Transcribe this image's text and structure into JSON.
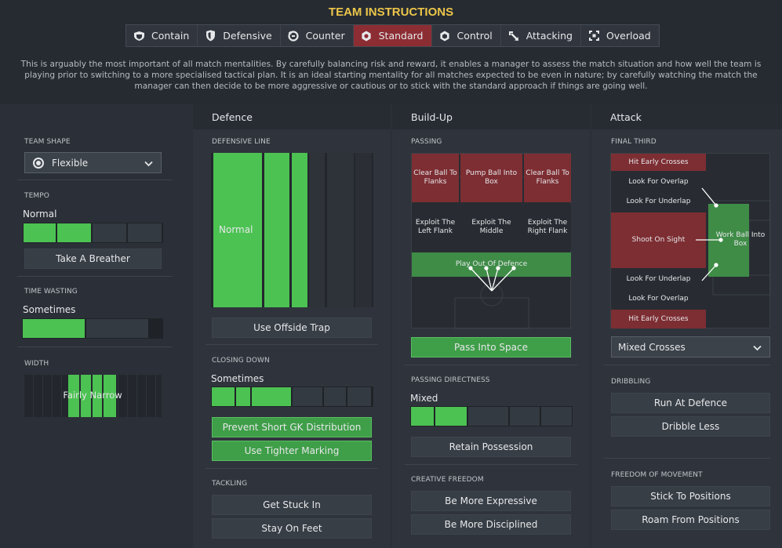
{
  "header": {
    "title": "TEAM INSTRUCTIONS",
    "tabs": [
      {
        "label": "Contain",
        "icon": "contain-icon",
        "active": false
      },
      {
        "label": "Defensive",
        "icon": "defensive-shield-icon",
        "active": false
      },
      {
        "label": "Counter",
        "icon": "counter-icon",
        "active": false
      },
      {
        "label": "Standard",
        "icon": "standard-icon",
        "active": true
      },
      {
        "label": "Control",
        "icon": "control-icon",
        "active": false
      },
      {
        "label": "Attacking",
        "icon": "attacking-icon",
        "active": false
      },
      {
        "label": "Overload",
        "icon": "overload-icon",
        "active": false
      }
    ],
    "description": "This is arguably the most important of all match mentalities. By carefully balancing risk and reward, it enables a manager to assess the match situation and how well the team is playing prior to switching to a more specialised tactical plan. It is an ideal starting mentality for all matches expected to be even in nature; by carefully watching the match the manager can then decide to be more aggressive or cautious or to stick with the standard approach if things are going well."
  },
  "general": {
    "team_shape": {
      "label": "TEAM SHAPE",
      "value": "Flexible"
    },
    "tempo": {
      "label": "TEMPO",
      "value": "Normal",
      "button": "Take A Breather"
    },
    "time_wasting": {
      "label": "TIME WASTING",
      "value": "Sometimes"
    },
    "width": {
      "label": "WIDTH",
      "value": "Fairly Narrow"
    }
  },
  "defence": {
    "header": "Defence",
    "defensive_line": {
      "label": "DEFENSIVE LINE",
      "value": "Normal",
      "button": "Use Offside Trap"
    },
    "closing_down": {
      "label": "CLOSING DOWN",
      "value": "Sometimes",
      "buttons": [
        "Prevent Short GK Distribution",
        "Use Tighter Marking"
      ]
    },
    "tackling": {
      "label": "TACKLING",
      "buttons": [
        "Get Stuck In",
        "Stay On Feet"
      ]
    }
  },
  "buildup": {
    "header": "Build-Up",
    "passing": {
      "label": "PASSING",
      "cells": [
        "Clear Ball To Flanks",
        "Pump Ball Into Box",
        "Clear Ball To Flanks",
        "Exploit The Left Flank",
        "Exploit The Middle",
        "Exploit The Right Flank",
        "Play Out Of Defence"
      ],
      "button": "Pass Into Space"
    },
    "passing_directness": {
      "label": "PASSING DIRECTNESS",
      "value": "Mixed",
      "button": "Retain Possession"
    },
    "creative_freedom": {
      "label": "CREATIVE FREEDOM",
      "buttons": [
        "Be More Expressive",
        "Be More Disciplined"
      ]
    }
  },
  "attack": {
    "header": "Attack",
    "final_third": {
      "label": "FINAL THIRD",
      "cells": [
        "Hit Early Crosses",
        "Look For Overlap",
        "Look For Underlap",
        "Shoot On Sight",
        "Work Ball Into Box",
        "Look For Underlap",
        "Look For Overlap",
        "Hit Early Crosses"
      ],
      "crossing": "Mixed Crosses"
    },
    "dribbling": {
      "label": "DRIBBLING",
      "buttons": [
        "Run At Defence",
        "Dribble Less"
      ]
    },
    "freedom": {
      "label": "FREEDOM OF MOVEMENT",
      "buttons": [
        "Stick To Positions",
        "Roam From Positions"
      ]
    }
  },
  "colors": {
    "accent": "#ecc54a",
    "active_tab": "#8c2d33",
    "selected_green": "#4cc252",
    "red_zone": "#7d2e33"
  }
}
